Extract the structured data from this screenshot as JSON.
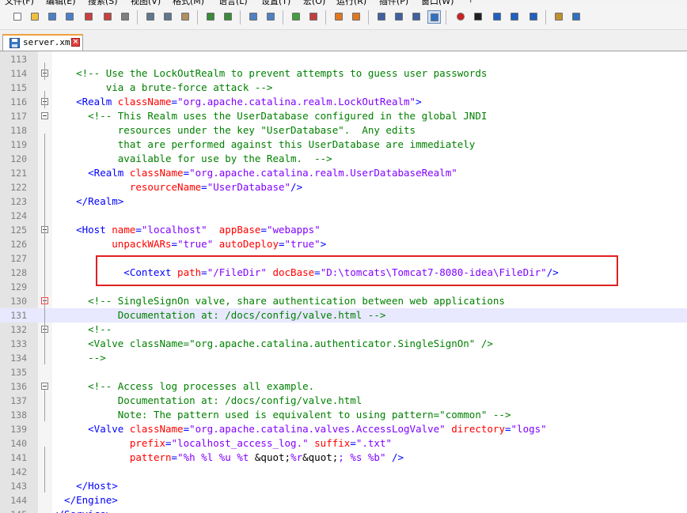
{
  "menu": [
    "文件(F)",
    "编辑(E)",
    "搜索(S)",
    "视图(V)",
    "格式(M)",
    "语言(L)",
    "设置(T)",
    "宏(O)",
    "运行(R)",
    "插件(P)",
    "窗口(W)",
    "?"
  ],
  "toolbar_icons": [
    "new-file-icon",
    "open-file-icon",
    "save-icon",
    "save-all-icon",
    "close-icon",
    "close-all-icon",
    "print-icon",
    "cut-icon",
    "copy-icon",
    "paste-icon",
    "undo-icon",
    "redo-icon",
    "find-icon",
    "replace-icon",
    "zoom-in-icon",
    "zoom-out-icon",
    "sync-vertical-icon",
    "sync-horizontal-icon",
    "word-wrap-icon",
    "show-all-chars-icon",
    "indent-guide-icon",
    "user-language-icon",
    "record-macro-icon",
    "stop-record-icon",
    "play-macro-icon",
    "run-macro-multiple-icon",
    "save-macro-icon",
    "doc-map-icon",
    "spell-check-icon"
  ],
  "tab": {
    "label": "server.xml"
  },
  "editor": {
    "current_line": "131",
    "lines": [
      {
        "n": "113",
        "t": []
      },
      {
        "n": "114",
        "t": [
          [
            "    <!-- Use the LockOutRealm to prevent attempts to guess user passwords",
            "com"
          ]
        ]
      },
      {
        "n": "115",
        "t": [
          [
            "         via a brute-force attack -->",
            "com"
          ]
        ]
      },
      {
        "n": "116",
        "t": [
          [
            "    <Realm ",
            "tag"
          ],
          [
            "className",
            "attr"
          ],
          [
            "=",
            "tag"
          ],
          [
            "\"org.apache.catalina.realm.LockOutRealm\"",
            "val"
          ],
          [
            ">",
            "tag"
          ]
        ]
      },
      {
        "n": "117",
        "t": [
          [
            "      <!-- This Realm uses the UserDatabase configured in the global JNDI",
            "com"
          ]
        ]
      },
      {
        "n": "118",
        "t": [
          [
            "           resources under the key \"UserDatabase\".  Any edits",
            "com"
          ]
        ]
      },
      {
        "n": "119",
        "t": [
          [
            "           that are performed against this UserDatabase are immediately",
            "com"
          ]
        ]
      },
      {
        "n": "120",
        "t": [
          [
            "           available for use by the Realm.  -->",
            "com"
          ]
        ]
      },
      {
        "n": "121",
        "t": [
          [
            "      <Realm ",
            "tag"
          ],
          [
            "className",
            "attr"
          ],
          [
            "=",
            "tag"
          ],
          [
            "\"org.apache.catalina.realm.UserDatabaseRealm\"",
            "val"
          ]
        ]
      },
      {
        "n": "122",
        "t": [
          [
            "             ",
            "txt"
          ],
          [
            "resourceName",
            "attr"
          ],
          [
            "=",
            "tag"
          ],
          [
            "\"UserDatabase\"",
            "val"
          ],
          [
            "/>",
            "tag"
          ]
        ]
      },
      {
        "n": "123",
        "t": [
          [
            "    </Realm>",
            "tag"
          ]
        ]
      },
      {
        "n": "124",
        "t": []
      },
      {
        "n": "125",
        "t": [
          [
            "    <Host ",
            "tag"
          ],
          [
            "name",
            "attr"
          ],
          [
            "=",
            "tag"
          ],
          [
            "\"localhost\"",
            "val"
          ],
          [
            "  ",
            "txt"
          ],
          [
            "appBase",
            "attr"
          ],
          [
            "=",
            "tag"
          ],
          [
            "\"webapps\"",
            "val"
          ]
        ]
      },
      {
        "n": "126",
        "t": [
          [
            "          ",
            "txt"
          ],
          [
            "unpackWARs",
            "attr"
          ],
          [
            "=",
            "tag"
          ],
          [
            "\"true\"",
            "val"
          ],
          [
            " ",
            "txt"
          ],
          [
            "autoDeploy",
            "attr"
          ],
          [
            "=",
            "tag"
          ],
          [
            "\"true\"",
            "val"
          ],
          [
            ">",
            "tag"
          ]
        ]
      },
      {
        "n": "127",
        "t": []
      },
      {
        "n": "128",
        "t": [
          [
            "            <Context ",
            "tag"
          ],
          [
            "path",
            "attr"
          ],
          [
            "=",
            "tag"
          ],
          [
            "\"/FileDir\"",
            "val"
          ],
          [
            " ",
            "txt"
          ],
          [
            "docBase",
            "attr"
          ],
          [
            "=",
            "tag"
          ],
          [
            "\"D:\\tomcats\\Tomcat7-8080-idea\\FileDir\"",
            "val"
          ],
          [
            "/>",
            "tag"
          ]
        ]
      },
      {
        "n": "129",
        "t": []
      },
      {
        "n": "130",
        "t": [
          [
            "      <!-- SingleSignOn valve, share authentication between web applications",
            "com"
          ]
        ]
      },
      {
        "n": "131",
        "t": [
          [
            "           Documentation at: /docs/config/valve.html -->",
            "com"
          ]
        ]
      },
      {
        "n": "132",
        "t": [
          [
            "      <!--",
            "com"
          ]
        ]
      },
      {
        "n": "133",
        "t": [
          [
            "      <Valve className=\"org.apache.catalina.authenticator.SingleSignOn\" />",
            "com"
          ]
        ]
      },
      {
        "n": "134",
        "t": [
          [
            "      -->",
            "com"
          ]
        ]
      },
      {
        "n": "135",
        "t": []
      },
      {
        "n": "136",
        "t": [
          [
            "      <!-- Access log processes all example.",
            "com"
          ]
        ]
      },
      {
        "n": "137",
        "t": [
          [
            "           Documentation at: /docs/config/valve.html",
            "com"
          ]
        ]
      },
      {
        "n": "138",
        "t": [
          [
            "           Note: The pattern used is equivalent to using pattern=\"common\" -->",
            "com"
          ]
        ]
      },
      {
        "n": "139",
        "t": [
          [
            "      <Valve ",
            "tag"
          ],
          [
            "className",
            "attr"
          ],
          [
            "=",
            "tag"
          ],
          [
            "\"org.apache.catalina.valves.AccessLogValve\"",
            "val"
          ],
          [
            " ",
            "txt"
          ],
          [
            "directory",
            "attr"
          ],
          [
            "=",
            "tag"
          ],
          [
            "\"logs\"",
            "val"
          ]
        ]
      },
      {
        "n": "140",
        "t": [
          [
            "             ",
            "txt"
          ],
          [
            "prefix",
            "attr"
          ],
          [
            "=",
            "tag"
          ],
          [
            "\"localhost_access_log.\"",
            "val"
          ],
          [
            " ",
            "txt"
          ],
          [
            "suffix",
            "attr"
          ],
          [
            "=",
            "tag"
          ],
          [
            "\".txt\"",
            "val"
          ]
        ]
      },
      {
        "n": "141",
        "t": [
          [
            "             ",
            "txt"
          ],
          [
            "pattern",
            "attr"
          ],
          [
            "=",
            "tag"
          ],
          [
            "\"%h %l %u %t ",
            "val"
          ],
          [
            "&quot;",
            "ent"
          ],
          [
            "%r",
            "val"
          ],
          [
            "&quot;",
            "ent"
          ],
          [
            "; %s %b\"",
            "val"
          ],
          [
            " />",
            "tag"
          ]
        ]
      },
      {
        "n": "142",
        "t": []
      },
      {
        "n": "143",
        "t": [
          [
            "    </Host>",
            "tag"
          ]
        ]
      },
      {
        "n": "144",
        "t": [
          [
            "  </Engine>",
            "tag"
          ]
        ]
      },
      {
        "n": "145",
        "t": [
          [
            "</Service>",
            "tag"
          ]
        ]
      }
    ]
  }
}
